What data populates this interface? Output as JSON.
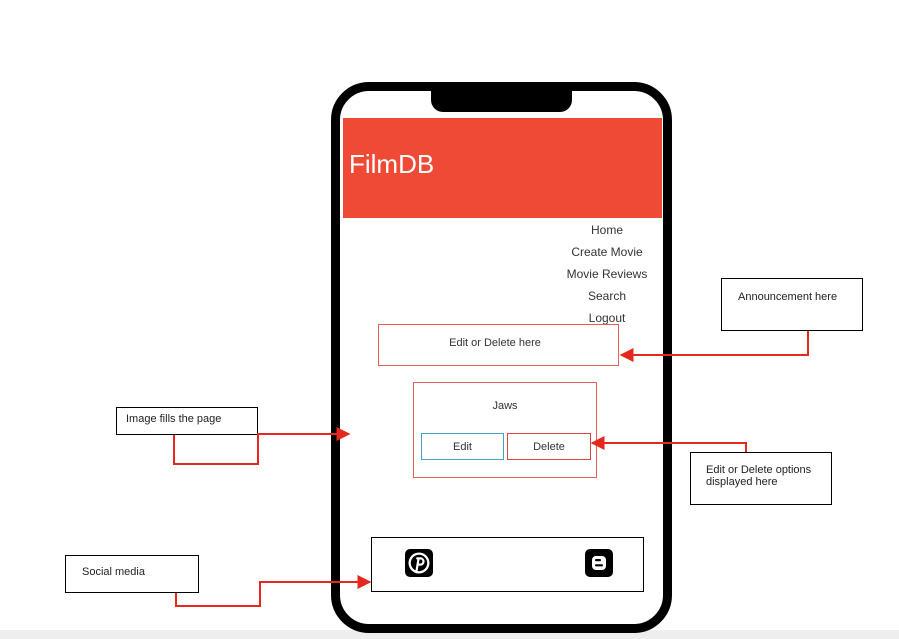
{
  "app": {
    "title": "FilmDB"
  },
  "nav": {
    "items": [
      "Home",
      "Create Movie",
      "Movie Reviews",
      "Search",
      "Logout"
    ]
  },
  "announcement": {
    "text": "Edit or Delete here"
  },
  "movie": {
    "title": "Jaws",
    "edit_label": "Edit",
    "delete_label": "Delete"
  },
  "social": {
    "icons": [
      "pinterest-icon",
      "blogger-icon"
    ]
  },
  "notes": {
    "announcement": "Announcement here",
    "image": "Image fills the page",
    "edit_delete": "Edit or Delete options displayed here",
    "social": "Social media"
  },
  "colors": {
    "header": "#ee4a36",
    "arrow": "#e5281e",
    "edit_border": "#41a6c4",
    "delete_border": "#dd4444"
  }
}
